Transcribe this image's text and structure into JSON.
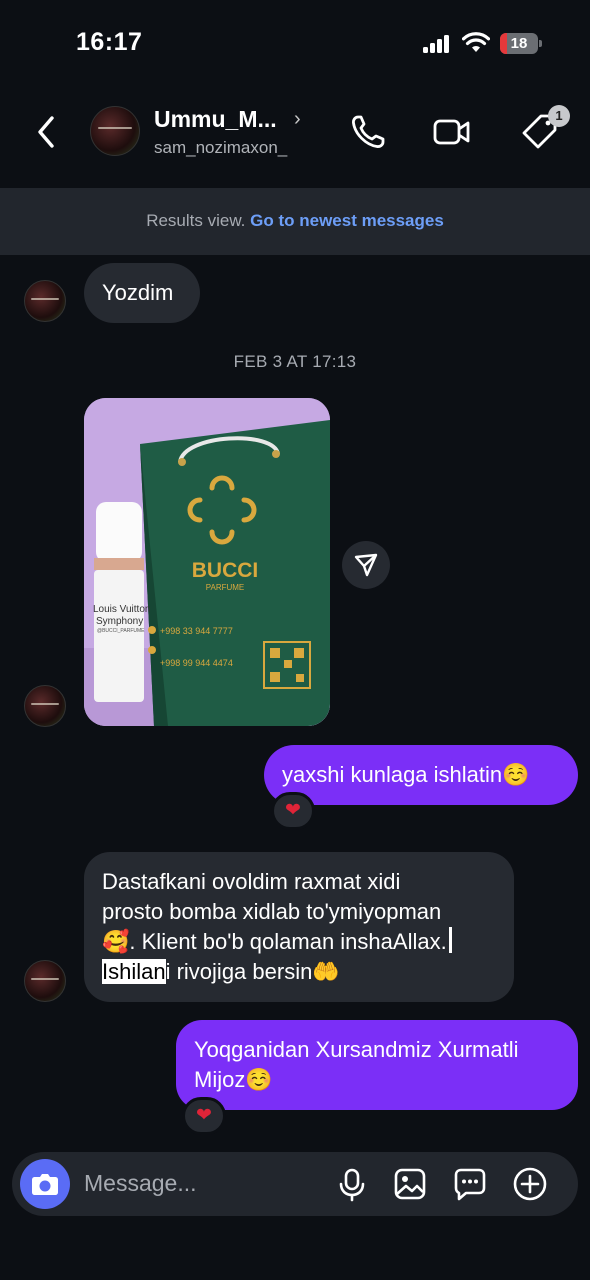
{
  "status_bar": {
    "time": "16:17",
    "battery": "18",
    "battery_percent": 18
  },
  "header": {
    "name": "Ummu_M...",
    "username": "sam_nozimaxon_",
    "tag_badge_count": "1"
  },
  "results_bar": {
    "text": "Results view.",
    "link": "Go to newest messages"
  },
  "messages": {
    "m1": {
      "text": "Yozdim"
    },
    "date_separator": "FEB 3 AT 17:13",
    "photo": {
      "brand": "BUCCI",
      "brand_sub": "PARFUME",
      "phone1": "+998 33 944 7777",
      "phone2": "+998 99 944 4474",
      "bottle_line1": "Louis Vuitton",
      "bottle_line2": "Symphony",
      "bottle_line3": "@BUCCI_PARFUME"
    },
    "m2": {
      "text": "yaxshi kunlaga ishlatin☺️",
      "reaction": "❤"
    },
    "m3": {
      "line1": "Dastafkani ovoldim raxmat xidi",
      "line2": "prosto bomba xidlab to'ymiyopman",
      "line3_emoji": "🥰",
      "line3_text": ". Klient bo'b qolaman inshaAllax.",
      "line4_highlight": "Ishilan",
      "line4_rest": "i rivojiga bersin🤲"
    },
    "m4": {
      "line1": "Yoqganidan Xursandmiz Xurmatli",
      "line2": "Mijoz☺️",
      "reaction": "❤"
    }
  },
  "composer": {
    "placeholder": "Message..."
  },
  "icons": {
    "back": "back-chevron-icon",
    "call": "phone-icon",
    "video": "video-camera-icon",
    "tag": "tag-icon",
    "share": "send-icon",
    "camera": "camera-icon",
    "mic": "microphone-icon",
    "gallery": "image-icon",
    "sticker": "chat-bubble-icon",
    "add": "plus-circle-icon"
  },
  "colors": {
    "background": "#0c0f14",
    "incoming_bubble": "#262a31",
    "outgoing_bubble": "#7b2ff7",
    "link": "#6d9ef7",
    "camera_button": "#5a6cf5"
  }
}
